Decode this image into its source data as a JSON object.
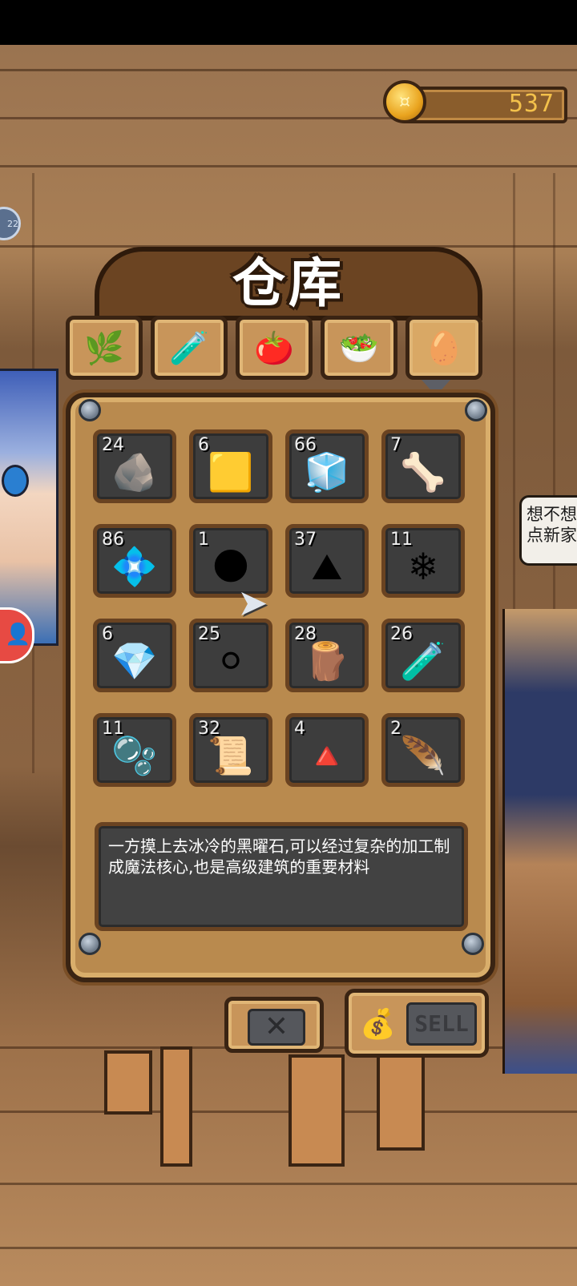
{
  "currency": {
    "amount": "537",
    "icon": "gold-coin-icon"
  },
  "title": "仓库",
  "tabs": [
    {
      "icon": "plant-icon",
      "glyph": "🌿"
    },
    {
      "icon": "potion-vial-icon",
      "glyph": "🧪"
    },
    {
      "icon": "vegetables-icon",
      "glyph": "🍅"
    },
    {
      "icon": "food-bowl-icon",
      "glyph": "🥗"
    },
    {
      "icon": "egg-nest-icon",
      "glyph": "🥚"
    }
  ],
  "items": [
    {
      "count": "24",
      "icon": "stones-icon",
      "glyph": "🪨"
    },
    {
      "count": "6",
      "icon": "gold-ore-icon",
      "glyph": "🟨"
    },
    {
      "count": "66",
      "icon": "salt-cube-icon",
      "glyph": "🧊"
    },
    {
      "count": "7",
      "icon": "bone-icon",
      "glyph": "🦴"
    },
    {
      "count": "86",
      "icon": "blue-gem-icon",
      "glyph": "💠"
    },
    {
      "count": "1",
      "icon": "obsidian-icon",
      "glyph": "🌑"
    },
    {
      "count": "37",
      "icon": "sand-pile-icon",
      "glyph": "⛰"
    },
    {
      "count": "11",
      "icon": "white-crystal-icon",
      "glyph": "❄"
    },
    {
      "count": "6",
      "icon": "ice-crystal-icon",
      "glyph": "💎"
    },
    {
      "count": "25",
      "icon": "snowball-icon",
      "glyph": "⚪"
    },
    {
      "count": "28",
      "icon": "wood-plank-icon",
      "glyph": "🪵"
    },
    {
      "count": "26",
      "icon": "green-potion-icon",
      "glyph": "🧪"
    },
    {
      "count": "11",
      "icon": "slime-icon",
      "glyph": "🫧"
    },
    {
      "count": "32",
      "icon": "cloth-roll-icon",
      "glyph": "📜"
    },
    {
      "count": "4",
      "icon": "flour-pile-icon",
      "glyph": "🔺"
    },
    {
      "count": "2",
      "icon": "feather-icon",
      "glyph": "🪶"
    }
  ],
  "description": "一方摸上去冰冷的黑曜石,可以经过复杂的加工制成魔法核心,也是高级建筑的重要材料",
  "speech_text": "想不想\n点新家",
  "buttons": {
    "close": "✕",
    "sell": "SELL",
    "sell_icon": "gold-bag-icon"
  },
  "side_badge": "22",
  "cursor_icon": "pointer-cursor-icon",
  "colors": {
    "panel": "#b98a4e",
    "slot": "#3d3d3d",
    "coin_text": "#f3c14b"
  }
}
